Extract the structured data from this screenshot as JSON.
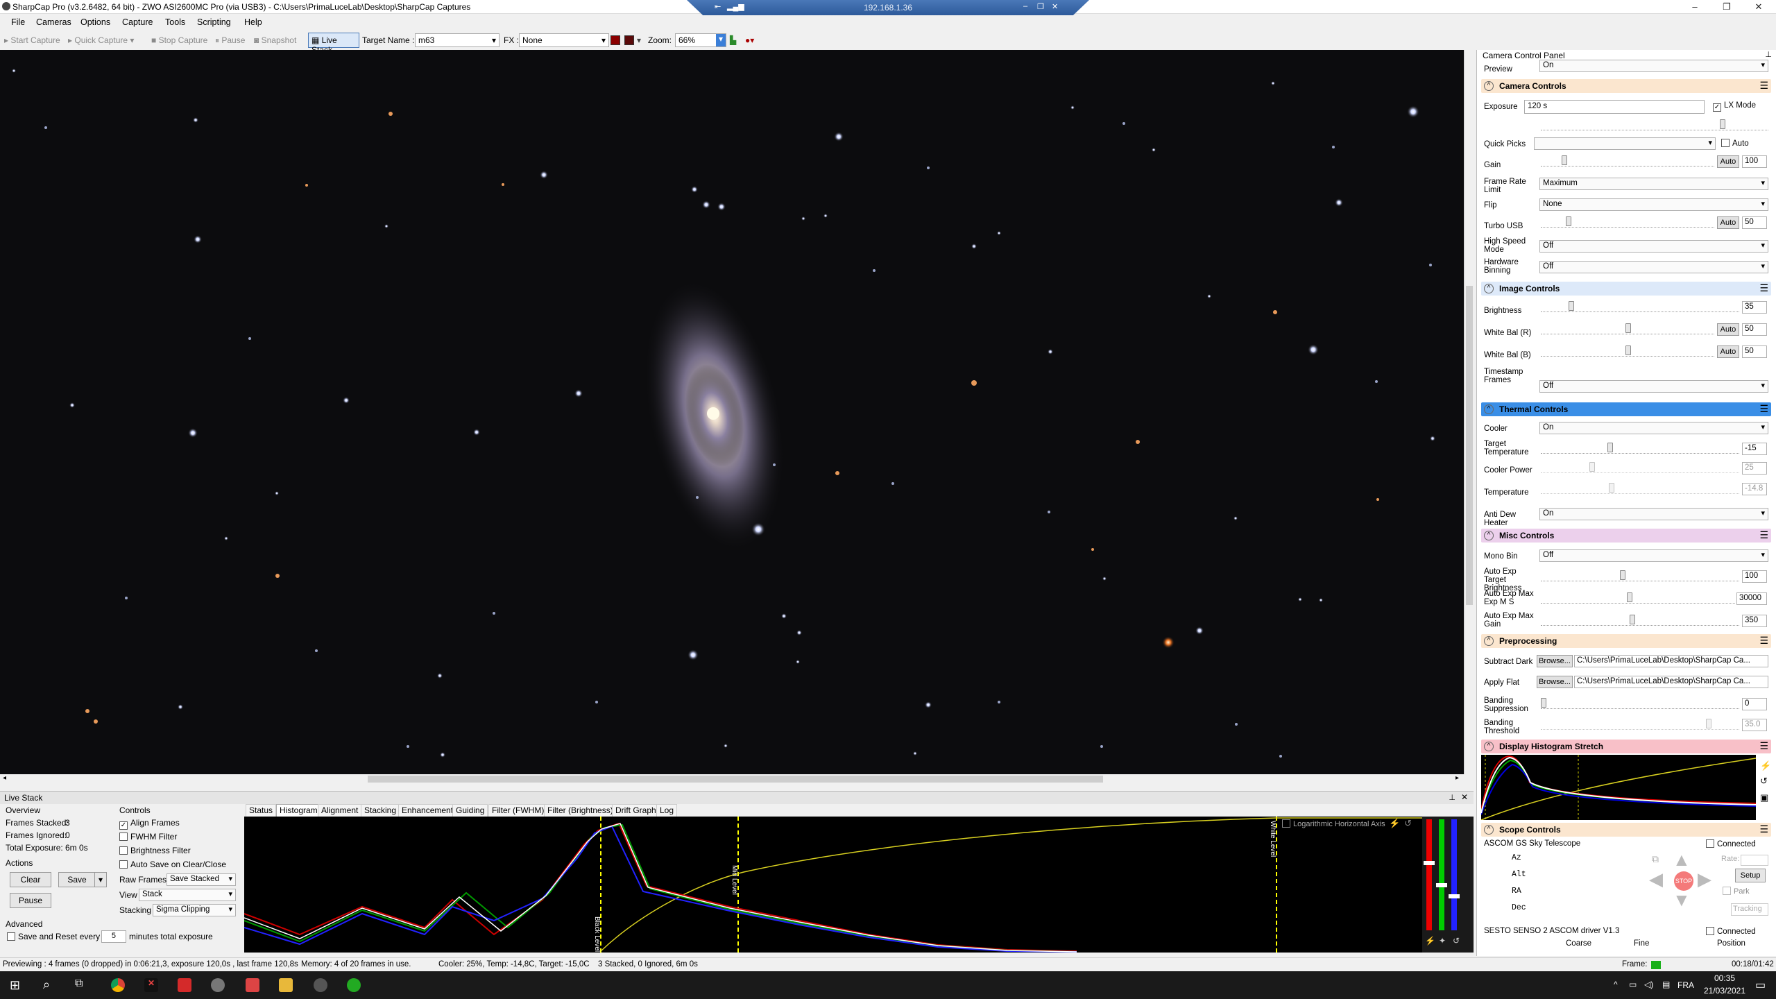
{
  "window": {
    "title": "SharpCap Pro (v3.2.6482, 64 bit) - ZWO ASI2600MC Pro (via USB3) - C:\\Users\\PrimaLuceLab\\Desktop\\SharpCap Captures",
    "remote_host": "192.168.1.36",
    "controls": [
      "–",
      "❐",
      "✕"
    ]
  },
  "menu": [
    "File",
    "Cameras",
    "Options",
    "Capture",
    "Tools",
    "Scripting",
    "Help"
  ],
  "toolbar": {
    "start_capture": "Start Capture",
    "quick_capture": "Quick Capture",
    "stop_capture": "Stop Capture",
    "pause": "Pause",
    "snapshot": "Snapshot",
    "live_stack": "Live Stack",
    "target_label": "Target Name :",
    "target_value": "m63",
    "fx_label": "FX :",
    "fx_value": "None",
    "zoom_label": "Zoom:",
    "zoom_value": "66%"
  },
  "ccp": {
    "title": "Camera Control Panel",
    "preview_label": "Preview",
    "preview_value": "On",
    "groups": {
      "camera": "Camera Controls",
      "image": "Image Controls",
      "thermal": "Thermal Controls",
      "misc": "Misc Controls",
      "pre": "Preprocessing",
      "hist": "Display Histogram Stretch",
      "scope": "Scope Controls"
    },
    "exposure_label": "Exposure",
    "exposure_value": "120 s",
    "lx_mode": "LX Mode",
    "quick_picks": "Quick Picks",
    "auto": "Auto",
    "gain_label": "Gain",
    "gain_value": "100",
    "frame_rate_label": "Frame Rate Limit",
    "frame_rate_value": "Maximum",
    "flip_label": "Flip",
    "flip_value": "None",
    "turbo_label": "Turbo USB",
    "turbo_value": "50",
    "hsm_label": "High Speed Mode",
    "hsm_value": "Off",
    "hwbin_label": "Hardware Binning",
    "hwbin_value": "Off",
    "brightness_label": "Brightness",
    "brightness_value": "35",
    "wbr_label": "White Bal (R)",
    "wbr_value": "50",
    "wbb_label": "White Bal (B)",
    "wbb_value": "50",
    "ts_label": "Timestamp Frames",
    "ts_value": "Off",
    "cooler_label": "Cooler",
    "cooler_value": "On",
    "tt_label": "Target Temperature",
    "tt_value": "-15",
    "cp_label": "Cooler Power",
    "cp_value": "25",
    "temp_label": "Temperature",
    "temp_value": "-14.8",
    "adh_label": "Anti Dew Heater",
    "adh_value": "On",
    "mono_label": "Mono Bin",
    "mono_value": "Off",
    "aetb_label": "Auto Exp Target Brightness",
    "aetb_value": "100",
    "aeme_label": "Auto Exp Max Exp M S",
    "aeme_value": "30000",
    "aemg_label": "Auto Exp Max Gain",
    "aemg_value": "350",
    "sd_label": "Subtract Dark",
    "sd_path": "C:\\Users\\PrimaLuceLab\\Desktop\\SharpCap Ca...",
    "af_label": "Apply Flat",
    "af_path": "C:\\Users\\PrimaLuceLab\\Desktop\\SharpCap Ca...",
    "browse": "Browse...",
    "bs_label": "Banding Suppression",
    "bs_value": "0",
    "bt_label": "Banding Threshold",
    "bt_value": "35.0",
    "scope1": "ASCOM GS Sky Telescope",
    "scope2": "SESTO SENSO 2 ASCOM driver V1.3",
    "connected": "Connected",
    "az": "Az",
    "alt": "Alt",
    "ra": "RA",
    "dec": "Dec",
    "rate": "Rate:",
    "setup": "Setup",
    "park": "Park",
    "tracking": "Tracking",
    "stop": "STOP",
    "coarse": "Coarse",
    "fine": "Fine",
    "position": "Position"
  },
  "livestack": {
    "title": "Live Stack",
    "overview": "Overview",
    "frames_stacked_label": "Frames Stacked:",
    "frames_stacked": "3",
    "frames_ignored_label": "Frames Ignored:",
    "frames_ignored": "0",
    "total_exp_label": "Total Exposure:",
    "total_exp": "6m 0s",
    "actions": "Actions",
    "clear": "Clear",
    "save": "Save",
    "pause": "Pause",
    "advanced": "Advanced",
    "save_reset": "Save and Reset every",
    "save_reset_value": "5",
    "save_reset_suffix": "minutes total exposure",
    "controls": "Controls",
    "align": "Align Frames",
    "fwhm": "FWHM Filter",
    "brightness": "Brightness Filter",
    "autosave": "Auto Save on Clear/Close",
    "raw_label": "Raw Frames",
    "raw_value": "Save Stacked",
    "view_label": "View",
    "view_value": "Stack",
    "stacking_label": "Stacking",
    "stacking_value": "Sigma Clipping",
    "tabs": [
      "Status",
      "Histogram",
      "Alignment",
      "Stacking",
      "Enhancement",
      "Guiding",
      "Filter (FWHM)",
      "Filter (Brightness)",
      "Drift Graph",
      "Log"
    ],
    "active_tab": 1,
    "log_axis": "Logarithmic Horizontal Axis",
    "black_level": "Black Level",
    "mid_level": "Mid Level",
    "white_level": "White Level"
  },
  "status": {
    "preview": "Previewing : 4 frames (0 dropped) in 0:06:21,3, exposure 120,0s , last frame 120,8s",
    "memory": "Memory: 4 of 20 frames in use.",
    "cooler": "Cooler: 25%, Temp: -14,8C, Target: -15,0C",
    "stacked": "3 Stacked, 0 Ignored, 6m 0s",
    "frame": "Frame:",
    "elapsed": "00:18/01:42"
  },
  "taskbar": {
    "lang": "FRA",
    "time": "00:35",
    "date": "21/03/2021"
  }
}
